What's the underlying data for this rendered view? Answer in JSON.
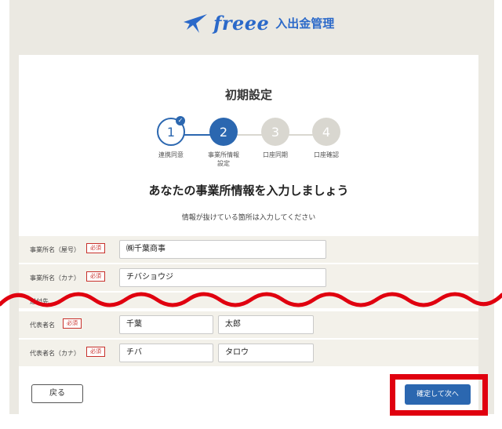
{
  "header": {
    "brand": "freee",
    "product": "入出金管理"
  },
  "page": {
    "title": "初期設定",
    "headline": "あなたの事業所情報を入力しましょう",
    "subtext": "情報が抜けている箇所は入力してください"
  },
  "steps": [
    {
      "number": "1",
      "label": "連携同意",
      "state": "done"
    },
    {
      "number": "2",
      "label": "事業所情報\n設定",
      "state": "current"
    },
    {
      "number": "3",
      "label": "口座同期",
      "state": "todo"
    },
    {
      "number": "4",
      "label": "口座確認",
      "state": "todo"
    }
  ],
  "form": {
    "required_label": "必須",
    "business_name": {
      "label": "事業所名（屋号）",
      "value": "㈱千葉商事"
    },
    "business_name_kana": {
      "label": "事業所名（カナ）",
      "value": "チバショウジ"
    },
    "partial_label": "送付先",
    "rep_name": {
      "label": "代表者名",
      "last": "千葉",
      "first": "太郎"
    },
    "rep_name_kana": {
      "label": "代表者名（カナ）",
      "last": "チバ",
      "first": "タロウ"
    }
  },
  "buttons": {
    "back": "戻る",
    "next": "確定して次へ"
  },
  "colors": {
    "primary": "#2b67b0",
    "highlight": "#e0000f",
    "required": "#c8312c"
  }
}
